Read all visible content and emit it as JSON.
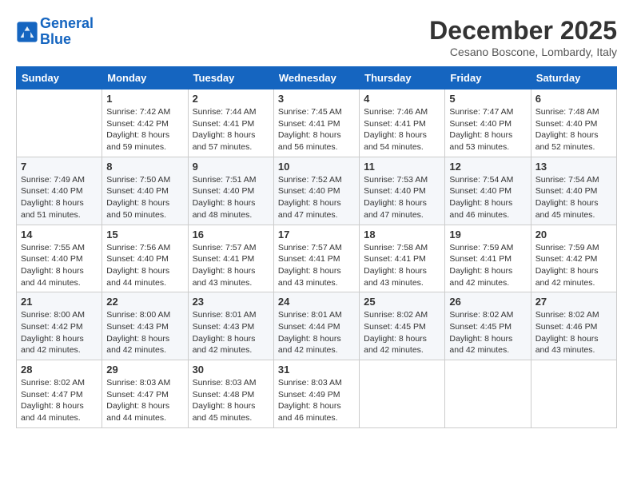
{
  "header": {
    "logo_line1": "General",
    "logo_line2": "Blue",
    "month_title": "December 2025",
    "location": "Cesano Boscone, Lombardy, Italy"
  },
  "days_of_week": [
    "Sunday",
    "Monday",
    "Tuesday",
    "Wednesday",
    "Thursday",
    "Friday",
    "Saturday"
  ],
  "weeks": [
    [
      {
        "day": "",
        "sunrise": "",
        "sunset": "",
        "daylight": ""
      },
      {
        "day": "1",
        "sunrise": "Sunrise: 7:42 AM",
        "sunset": "Sunset: 4:42 PM",
        "daylight": "Daylight: 8 hours and 59 minutes."
      },
      {
        "day": "2",
        "sunrise": "Sunrise: 7:44 AM",
        "sunset": "Sunset: 4:41 PM",
        "daylight": "Daylight: 8 hours and 57 minutes."
      },
      {
        "day": "3",
        "sunrise": "Sunrise: 7:45 AM",
        "sunset": "Sunset: 4:41 PM",
        "daylight": "Daylight: 8 hours and 56 minutes."
      },
      {
        "day": "4",
        "sunrise": "Sunrise: 7:46 AM",
        "sunset": "Sunset: 4:41 PM",
        "daylight": "Daylight: 8 hours and 54 minutes."
      },
      {
        "day": "5",
        "sunrise": "Sunrise: 7:47 AM",
        "sunset": "Sunset: 4:40 PM",
        "daylight": "Daylight: 8 hours and 53 minutes."
      },
      {
        "day": "6",
        "sunrise": "Sunrise: 7:48 AM",
        "sunset": "Sunset: 4:40 PM",
        "daylight": "Daylight: 8 hours and 52 minutes."
      }
    ],
    [
      {
        "day": "7",
        "sunrise": "Sunrise: 7:49 AM",
        "sunset": "Sunset: 4:40 PM",
        "daylight": "Daylight: 8 hours and 51 minutes."
      },
      {
        "day": "8",
        "sunrise": "Sunrise: 7:50 AM",
        "sunset": "Sunset: 4:40 PM",
        "daylight": "Daylight: 8 hours and 50 minutes."
      },
      {
        "day": "9",
        "sunrise": "Sunrise: 7:51 AM",
        "sunset": "Sunset: 4:40 PM",
        "daylight": "Daylight: 8 hours and 48 minutes."
      },
      {
        "day": "10",
        "sunrise": "Sunrise: 7:52 AM",
        "sunset": "Sunset: 4:40 PM",
        "daylight": "Daylight: 8 hours and 47 minutes."
      },
      {
        "day": "11",
        "sunrise": "Sunrise: 7:53 AM",
        "sunset": "Sunset: 4:40 PM",
        "daylight": "Daylight: 8 hours and 47 minutes."
      },
      {
        "day": "12",
        "sunrise": "Sunrise: 7:54 AM",
        "sunset": "Sunset: 4:40 PM",
        "daylight": "Daylight: 8 hours and 46 minutes."
      },
      {
        "day": "13",
        "sunrise": "Sunrise: 7:54 AM",
        "sunset": "Sunset: 4:40 PM",
        "daylight": "Daylight: 8 hours and 45 minutes."
      }
    ],
    [
      {
        "day": "14",
        "sunrise": "Sunrise: 7:55 AM",
        "sunset": "Sunset: 4:40 PM",
        "daylight": "Daylight: 8 hours and 44 minutes."
      },
      {
        "day": "15",
        "sunrise": "Sunrise: 7:56 AM",
        "sunset": "Sunset: 4:40 PM",
        "daylight": "Daylight: 8 hours and 44 minutes."
      },
      {
        "day": "16",
        "sunrise": "Sunrise: 7:57 AM",
        "sunset": "Sunset: 4:41 PM",
        "daylight": "Daylight: 8 hours and 43 minutes."
      },
      {
        "day": "17",
        "sunrise": "Sunrise: 7:57 AM",
        "sunset": "Sunset: 4:41 PM",
        "daylight": "Daylight: 8 hours and 43 minutes."
      },
      {
        "day": "18",
        "sunrise": "Sunrise: 7:58 AM",
        "sunset": "Sunset: 4:41 PM",
        "daylight": "Daylight: 8 hours and 43 minutes."
      },
      {
        "day": "19",
        "sunrise": "Sunrise: 7:59 AM",
        "sunset": "Sunset: 4:41 PM",
        "daylight": "Daylight: 8 hours and 42 minutes."
      },
      {
        "day": "20",
        "sunrise": "Sunrise: 7:59 AM",
        "sunset": "Sunset: 4:42 PM",
        "daylight": "Daylight: 8 hours and 42 minutes."
      }
    ],
    [
      {
        "day": "21",
        "sunrise": "Sunrise: 8:00 AM",
        "sunset": "Sunset: 4:42 PM",
        "daylight": "Daylight: 8 hours and 42 minutes."
      },
      {
        "day": "22",
        "sunrise": "Sunrise: 8:00 AM",
        "sunset": "Sunset: 4:43 PM",
        "daylight": "Daylight: 8 hours and 42 minutes."
      },
      {
        "day": "23",
        "sunrise": "Sunrise: 8:01 AM",
        "sunset": "Sunset: 4:43 PM",
        "daylight": "Daylight: 8 hours and 42 minutes."
      },
      {
        "day": "24",
        "sunrise": "Sunrise: 8:01 AM",
        "sunset": "Sunset: 4:44 PM",
        "daylight": "Daylight: 8 hours and 42 minutes."
      },
      {
        "day": "25",
        "sunrise": "Sunrise: 8:02 AM",
        "sunset": "Sunset: 4:45 PM",
        "daylight": "Daylight: 8 hours and 42 minutes."
      },
      {
        "day": "26",
        "sunrise": "Sunrise: 8:02 AM",
        "sunset": "Sunset: 4:45 PM",
        "daylight": "Daylight: 8 hours and 42 minutes."
      },
      {
        "day": "27",
        "sunrise": "Sunrise: 8:02 AM",
        "sunset": "Sunset: 4:46 PM",
        "daylight": "Daylight: 8 hours and 43 minutes."
      }
    ],
    [
      {
        "day": "28",
        "sunrise": "Sunrise: 8:02 AM",
        "sunset": "Sunset: 4:47 PM",
        "daylight": "Daylight: 8 hours and 44 minutes."
      },
      {
        "day": "29",
        "sunrise": "Sunrise: 8:03 AM",
        "sunset": "Sunset: 4:47 PM",
        "daylight": "Daylight: 8 hours and 44 minutes."
      },
      {
        "day": "30",
        "sunrise": "Sunrise: 8:03 AM",
        "sunset": "Sunset: 4:48 PM",
        "daylight": "Daylight: 8 hours and 45 minutes."
      },
      {
        "day": "31",
        "sunrise": "Sunrise: 8:03 AM",
        "sunset": "Sunset: 4:49 PM",
        "daylight": "Daylight: 8 hours and 46 minutes."
      },
      {
        "day": "",
        "sunrise": "",
        "sunset": "",
        "daylight": ""
      },
      {
        "day": "",
        "sunrise": "",
        "sunset": "",
        "daylight": ""
      },
      {
        "day": "",
        "sunrise": "",
        "sunset": "",
        "daylight": ""
      }
    ]
  ]
}
